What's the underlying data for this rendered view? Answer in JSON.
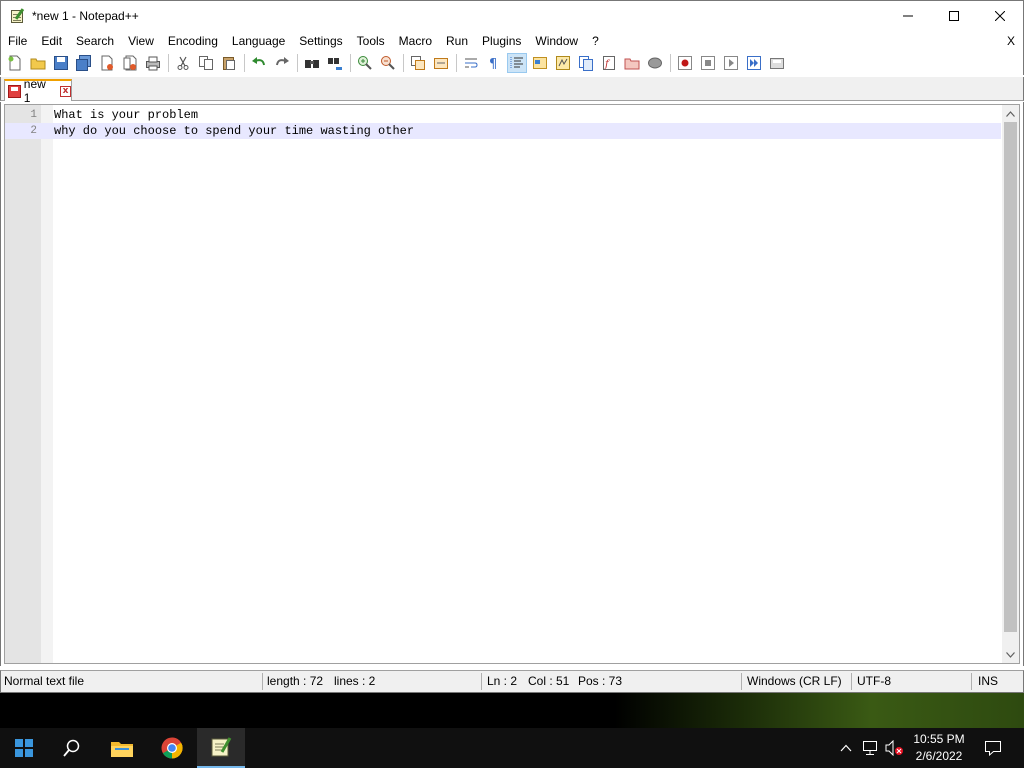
{
  "window": {
    "title": "*new 1 - Notepad++"
  },
  "menu": {
    "items": [
      "File",
      "Edit",
      "Search",
      "View",
      "Encoding",
      "Language",
      "Settings",
      "Tools",
      "Macro",
      "Run",
      "Plugins",
      "Window",
      "?"
    ],
    "close_label": "X"
  },
  "toolbar": {
    "icons": [
      "new-file-icon",
      "open-file-icon",
      "save-icon",
      "save-all-icon",
      "close-icon",
      "close-all-icon",
      "print-icon",
      "cut-icon",
      "copy-icon",
      "paste-icon",
      "undo-icon",
      "redo-icon",
      "find-icon",
      "replace-icon",
      "zoom-in-icon",
      "zoom-out-icon",
      "sync-vertical-icon",
      "sync-horizontal-icon",
      "word-wrap-icon",
      "show-all-chars-icon",
      "indent-guide-icon",
      "user-language-icon",
      "document-map-icon",
      "document-list-icon",
      "function-list-icon",
      "folder-as-workspace-icon",
      "monitoring-icon",
      "record-macro-icon",
      "stop-record-icon",
      "playback-icon",
      "run-macro-multiple-icon",
      "save-macro-icon"
    ]
  },
  "tabs": [
    {
      "label": "new 1",
      "close": "x"
    }
  ],
  "editor": {
    "lines": [
      {
        "number": "1",
        "text": "What is your problem"
      },
      {
        "number": "2",
        "text": "why do you choose to spend your time wasting other"
      }
    ]
  },
  "status": {
    "file_type": "Normal text file",
    "length": "length : 72",
    "lines": "lines : 2",
    "ln": "Ln : 2",
    "col": "Col : 51",
    "pos": "Pos : 73",
    "eol": "Windows (CR LF)",
    "encoding": "UTF-8",
    "mode": "INS"
  },
  "taskbar": {
    "time": "10:55 PM",
    "date": "2/6/2022"
  },
  "colors": {
    "current_line": "#e8e8ff",
    "tab_accent": "#f0a000",
    "taskbar": "#101010"
  }
}
